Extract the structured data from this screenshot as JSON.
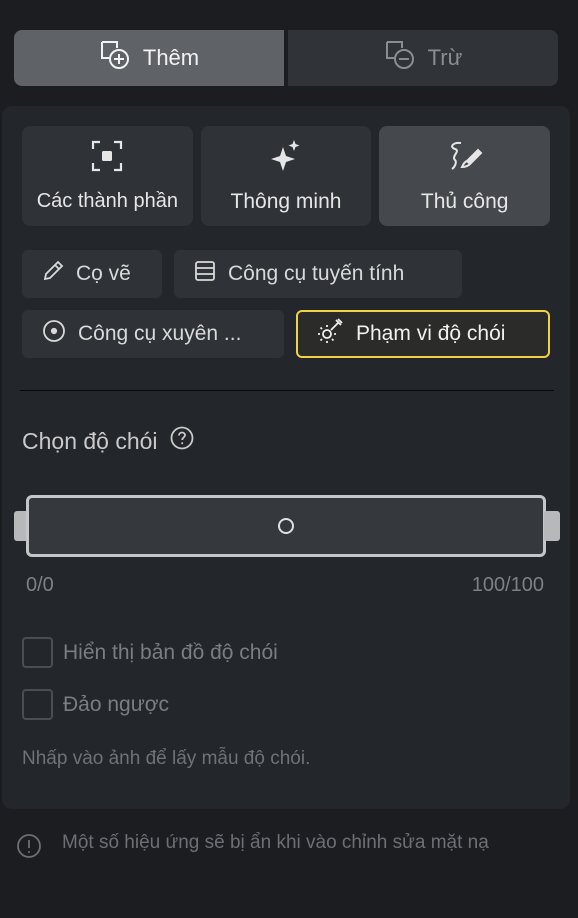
{
  "mode_switch": {
    "add_label": "Thêm",
    "subtract_label": "Trừ"
  },
  "selection_tools": [
    {
      "label": "Các thành phần",
      "icon": "component-select-icon"
    },
    {
      "label": "Thông minh",
      "icon": "sparkle-icon"
    },
    {
      "label": "Thủ công",
      "icon": "manual-brush-icon",
      "active": true
    }
  ],
  "sub_tools": [
    {
      "label": "Cọ vẽ",
      "icon": "brush-icon"
    },
    {
      "label": "Công cụ tuyến tính",
      "icon": "linear-gradient-icon"
    },
    {
      "label": "Công cụ xuyên ...",
      "icon": "radial-tool-icon"
    },
    {
      "label": "Phạm vi độ chói",
      "icon": "luminance-picker-icon",
      "selected": true
    }
  ],
  "luminance": {
    "title": "Chọn độ chói",
    "min_label": "0/0",
    "max_label": "100/100",
    "range_min": 0,
    "range_max": 100
  },
  "options": {
    "show_map_label": "Hiển thị bản đồ độ chói",
    "show_map_checked": false,
    "invert_label": "Đảo ngược",
    "invert_checked": false
  },
  "hint_text": "Nhấp vào ảnh để lấy mẫu độ chói.",
  "footer_note": "Một số hiệu ứng sẽ bị ẩn khi vào chỉnh sửa mặt nạ",
  "colors": {
    "background": "#1b1d21",
    "panel": "#23262a",
    "accent_selected": "#f1d245"
  }
}
